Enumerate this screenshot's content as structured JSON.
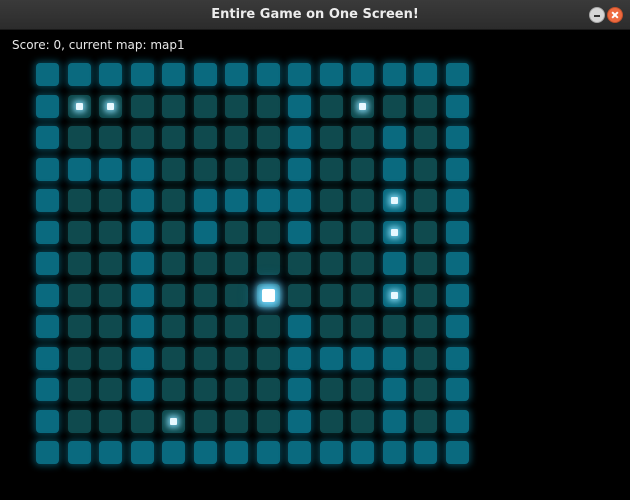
{
  "window": {
    "title": "Entire Game on One Screen!"
  },
  "hud": {
    "text": "Score: 0, current map: map1"
  },
  "colors": {
    "background": "#000000",
    "tile_dim": "#0f4a4e",
    "tile_bright": "#0a6a7f",
    "pickup": "#e8f8ff",
    "player": "#ffffff"
  },
  "map": {
    "rows": [
      "BBBBBBBBBBBBBB",
      "BDDDDDDDBDDDDB",
      "BDDDDDDDBDDBDB",
      "BBBBDDDDBDDBDB",
      "BDDBDBBBBDDBDB",
      "BDDBDBDDBDDBDB",
      "BDDBDDDDDDDBDB",
      "BDDBDDDDDDDBDB",
      "BDDBDDDDBDDDDB",
      "BDDBDDDDBBBBDB",
      "BDDBDDDDBDDBDB",
      "BDDDDDDDBDDBDB",
      "BBBBBBBBBBBBBB"
    ],
    "pickups": [
      {
        "row": 1,
        "col": 1
      },
      {
        "row": 1,
        "col": 2
      },
      {
        "row": 1,
        "col": 10
      },
      {
        "row": 4,
        "col": 11
      },
      {
        "row": 5,
        "col": 11
      },
      {
        "row": 7,
        "col": 11
      },
      {
        "row": 11,
        "col": 4
      }
    ],
    "player": {
      "row": 7,
      "col": 7
    }
  }
}
